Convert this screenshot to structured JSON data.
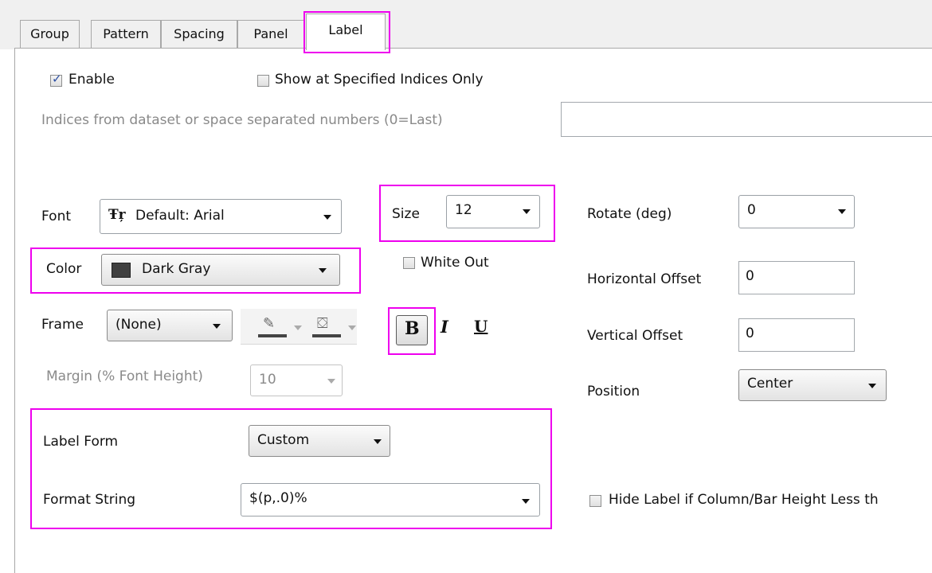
{
  "tabs": [
    "Group",
    "Pattern",
    "Spacing",
    "Panel",
    "Label"
  ],
  "active_tab": "Label",
  "enable_label": "Enable",
  "enable_checked": true,
  "show_specified_label": "Show at Specified Indices Only",
  "show_specified_checked": false,
  "indices_label": "Indices from dataset or space separated numbers (0=Last)",
  "indices_value": "",
  "font": {
    "label": "Font",
    "value": "Default: Arial",
    "icon": "font-icon"
  },
  "size": {
    "label": "Size",
    "value": "12"
  },
  "rotate": {
    "label": "Rotate (deg)",
    "value": "0"
  },
  "color": {
    "label": "Color",
    "value": "Dark Gray",
    "swatch": "#404040"
  },
  "white_out": {
    "label": "White Out",
    "checked": false
  },
  "horizontal_offset": {
    "label": "Horizontal Offset",
    "value": "0"
  },
  "frame": {
    "label": "Frame",
    "value": "(None)"
  },
  "style_buttons": {
    "bold": "B",
    "italic": "I",
    "underline": "U"
  },
  "vertical_offset": {
    "label": "Vertical Offset",
    "value": "0"
  },
  "margin": {
    "label": "Margin (% Font Height)",
    "value": "10"
  },
  "position": {
    "label": "Position",
    "value": "Center"
  },
  "label_form": {
    "label": "Label Form",
    "value": "Custom"
  },
  "format_string": {
    "label": "Format String",
    "value": "$(p,.0)%"
  },
  "hide_label": {
    "label": "Hide Label if Column/Bar Height Less th",
    "checked": false
  },
  "highlight_color": "#ee00ee"
}
